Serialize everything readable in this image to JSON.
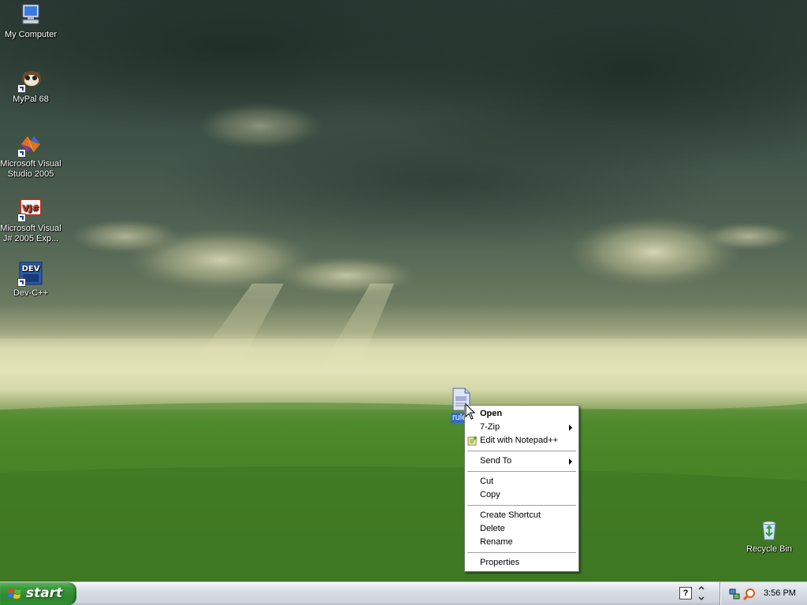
{
  "desktop": {
    "icons": [
      {
        "label_line1": "My Computer",
        "label_line2": "",
        "icon": "my-computer-icon"
      },
      {
        "label_line1": "MyPal 68",
        "label_line2": "",
        "icon": "mypal-icon"
      },
      {
        "label_line1": "Microsoft Visual",
        "label_line2": "Studio 2005",
        "icon": "visual-studio-icon"
      },
      {
        "label_line1": "Microsoft Visual",
        "label_line2": "J# 2005 Exp...",
        "icon": "visual-jsharp-icon"
      },
      {
        "label_line1": "Dev-C++",
        "label_line2": "",
        "icon": "dev-cpp-icon"
      }
    ],
    "recycle_bin": {
      "label": "Recycle Bin",
      "icon": "recycle-bin-icon"
    },
    "selected_file": {
      "label": "rule",
      "icon": "text-file-icon"
    }
  },
  "context_menu": {
    "items": [
      {
        "label": "Open",
        "bold": true
      },
      {
        "label": "7-Zip",
        "submenu": true
      },
      {
        "label": "Edit with Notepad++",
        "icon": "notepad-plus-plus-icon"
      },
      {
        "label": "Send To",
        "submenu": true
      },
      {
        "label": "Cut"
      },
      {
        "label": "Copy"
      },
      {
        "label": "Create Shortcut"
      },
      {
        "label": "Delete"
      },
      {
        "label": "Rename"
      },
      {
        "label": "Properties"
      }
    ]
  },
  "taskbar": {
    "start_label": "start",
    "clock": "3:56 PM",
    "quick_launch": "?",
    "colors": {
      "start_green": "#3c9a3c",
      "selection_blue": "#316ac5"
    }
  }
}
